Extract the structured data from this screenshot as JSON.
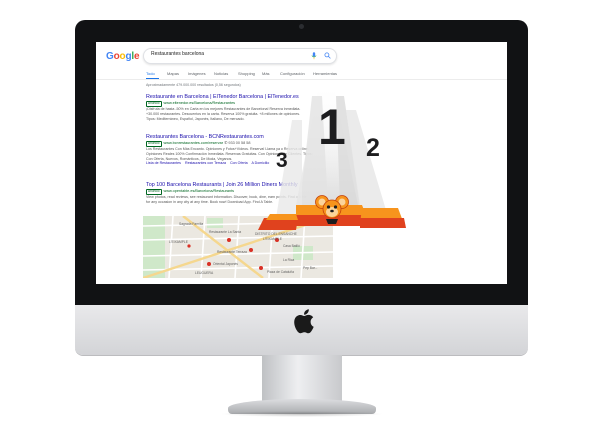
{
  "google": {
    "logo_letters": [
      {
        "char": "G",
        "color": "#4285F4"
      },
      {
        "char": "o",
        "color": "#EA4335"
      },
      {
        "char": "o",
        "color": "#FBBC05"
      },
      {
        "char": "g",
        "color": "#4285F4"
      },
      {
        "char": "l",
        "color": "#34A853"
      },
      {
        "char": "e",
        "color": "#EA4335"
      }
    ],
    "search_query": "Restaurantes barcelona"
  },
  "tabs": [
    "Todo",
    "Mapas",
    "Imágenes",
    "Noticias",
    "Shopping",
    "Más",
    "Configuración",
    "Herramientas"
  ],
  "stats_text": "Aproximadamente 479.000.000 resultados (0,56 segundos)",
  "results": [
    {
      "title": "Restaurante en Barcelona | ElTenedor Barcelona | ElTenedor.es",
      "badge": "Anuncio",
      "url": "www.eltenedor.es/Barcelona/Restaurantes",
      "desc": [
        "¡Disfruta de hasta -50% en Carta en los mejores Restaurantes de Barcelona! Reserva inmediata.",
        "+30.000 restaurantes. Descuentos en la carta. Reserva 100% gratuita. +8 millones de opiniones.",
        "Tipos: Mediterráneo, Español, Japonés, Italiano, De mercado."
      ],
      "links": []
    },
    {
      "title": "Restaurantes Barcelona - BCNRestaurantes.com",
      "badge": "Anuncio",
      "url": "www.bcnrestaurantes.com/reservar",
      "phone": "933 00 58 58",
      "desc": [
        "Los Restaurantes Con Más Encanto. Opiniones y Fotos+Vídeos. Reserva! Llama ya o Reserva online.",
        "Opiniones Reales 100% Confirmación Inmediata. Reservas Gratuitas. Con Opiniones de Clientes. Tipos:",
        "Con Oferta, Nuevos, Románticos, De Moda, Veganos."
      ],
      "links": [
        "Lista de Restaurantes",
        "Restaurantes con Terraza",
        "Con Oferta",
        "A Domicilio"
      ]
    },
    {
      "title": "Top 100 Barcelona Restaurants | Join 26 Million Diners Monthly",
      "badge": "Anuncio",
      "url": "www.opentable.es/Barcelona/Restaurants",
      "desc": [
        "View photos, read reviews, see restaurant information. Discover, book, dine, earn points. Find a table",
        "for any occasion in any city at any time. Book now! Download App. Find A Table."
      ],
      "links": []
    }
  ],
  "map_labels": [
    {
      "name": "map-label-sagrada",
      "text": "Sagrada Família"
    },
    {
      "name": "map-label-mercado",
      "text": "Mercado Fresca Barcelona"
    },
    {
      "name": "map-label-lasanta",
      "text": "Restaurante La Santa"
    },
    {
      "name": "map-label-distrito",
      "text": "DISTRITO DEL ENSANCHE"
    },
    {
      "name": "map-label-distrito-sub",
      "text": "L'EIXAMPLE"
    },
    {
      "name": "map-label-leixample",
      "text": "L'EIXAMPLE"
    },
    {
      "name": "map-label-casa-batllo",
      "text": "Casa Batlló"
    },
    {
      "name": "map-label-terraza",
      "text": "Restaurante Terraza"
    },
    {
      "name": "map-label-oriental",
      "text": "Oriental Japonés"
    },
    {
      "name": "map-label-larica",
      "text": "La Rica"
    },
    {
      "name": "map-label-leuguera",
      "text": "LEUGUERA"
    },
    {
      "name": "map-label-plaza-cat",
      "text": "Plaza de Cataluña"
    },
    {
      "name": "map-label-pep",
      "text": "Pep Bar..."
    }
  ],
  "podium": {
    "first": "1",
    "second": "2",
    "third": "3",
    "colors": {
      "podium_dark": "#e0421e",
      "podium_light": "#f7941d",
      "beam": "#ececec",
      "digit": "#1d1d1f"
    }
  },
  "colors": {
    "link_blue": "#1a0dab",
    "url_green": "#006621",
    "tab_active": "#1a73e8",
    "frame": "#111214"
  }
}
